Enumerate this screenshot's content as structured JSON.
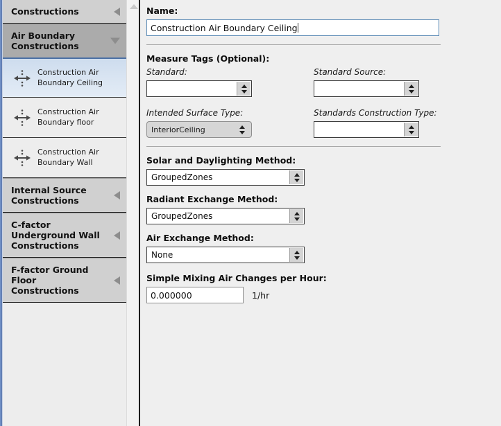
{
  "sidebar": {
    "sections": [
      {
        "label": "Constructions",
        "state": "collapsed",
        "caret": "caret-left-icon"
      },
      {
        "label": "Air Boundary Constructions",
        "state": "expanded",
        "caret": "caret-down-icon"
      }
    ],
    "items": [
      {
        "label": "Construction Air Boundary Ceiling",
        "icon": "air-boundary-icon",
        "selected": true
      },
      {
        "label": "Construction Air Boundary floor",
        "icon": "air-boundary-icon",
        "selected": false
      },
      {
        "label": "Construction Air Boundary Wall",
        "icon": "air-boundary-icon",
        "selected": false
      }
    ],
    "more_sections": [
      {
        "label": "Internal Source Constructions",
        "state": "collapsed",
        "caret": "caret-left-icon"
      },
      {
        "label": "C-factor Underground Wall Constructions",
        "state": "collapsed",
        "caret": "caret-left-icon"
      },
      {
        "label": "F-factor Ground Floor Constructions",
        "state": "collapsed",
        "caret": "caret-left-icon"
      }
    ]
  },
  "form": {
    "name_label": "Name:",
    "name_value": "Construction Air Boundary Ceiling",
    "measure_tags_label": "Measure Tags (Optional):",
    "standard_label": "Standard:",
    "standard_value": "",
    "standard_source_label": "Standard Source:",
    "standard_source_value": "",
    "intended_surface_type_label": "Intended Surface Type:",
    "intended_surface_type_value": "InteriorCeiling",
    "standards_construction_type_label": "Standards Construction Type:",
    "standards_construction_type_value": "",
    "solar_daylighting_label": "Solar and Daylighting Method:",
    "solar_daylighting_value": "GroupedZones",
    "radiant_exchange_label": "Radiant Exchange Method:",
    "radiant_exchange_value": "GroupedZones",
    "air_exchange_label": "Air Exchange Method:",
    "air_exchange_value": "None",
    "simple_mixing_label": "Simple Mixing Air Changes per Hour:",
    "simple_mixing_value": "0.000000",
    "simple_mixing_unit": "1/hr"
  },
  "colors": {
    "accent_blue": "#4a6fa5",
    "panel_bg": "#efefef",
    "header_gray": "#d0d0d0",
    "header_active_gray": "#ababab",
    "selected_row": "#d7e3f1"
  }
}
